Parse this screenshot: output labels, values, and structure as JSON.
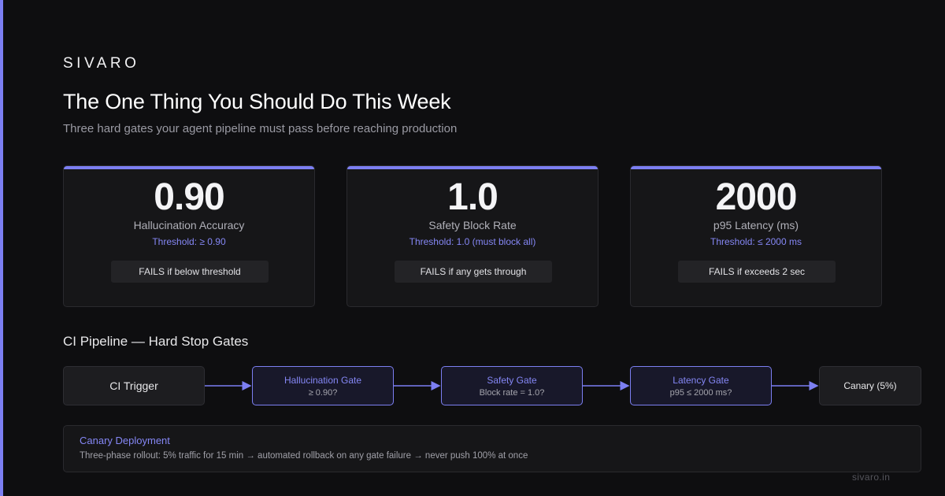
{
  "brand": "SIVARO",
  "title": "The One Thing You Should Do This Week",
  "subtitle": "Three hard gates your agent pipeline must pass before reaching production",
  "colors": {
    "accent": "#7c7ff2",
    "background": "#0e0e10",
    "card": "#161618"
  },
  "cards": [
    {
      "value": "0.90",
      "label": "Hallucination Accuracy",
      "threshold": "Threshold: ≥ 0.90",
      "fail": "FAILS if below threshold"
    },
    {
      "value": "1.0",
      "label": "Safety Block Rate",
      "threshold": "Threshold: 1.0 (must block all)",
      "fail": "FAILS if any gets through"
    },
    {
      "value": "2000",
      "label": "p95 Latency (ms)",
      "threshold": "Threshold: ≤ 2000 ms",
      "fail": "FAILS if exceeds 2 sec"
    }
  ],
  "pipeline": {
    "title": "CI Pipeline — Hard Stop Gates",
    "start": "CI Trigger",
    "gates": [
      {
        "title": "Hallucination Gate",
        "sub": "≥ 0.90?"
      },
      {
        "title": "Safety Gate",
        "sub": "Block rate = 1.0?"
      },
      {
        "title": "Latency Gate",
        "sub": "p95 ≤ 2000 ms?"
      }
    ],
    "end": "Canary (5%)"
  },
  "canary": {
    "title": "Canary Deployment",
    "description": "Three-phase rollout: 5% traffic for 15 min → automated rollback on any gate failure → never push 100% at once"
  },
  "footer": "sivaro.in"
}
